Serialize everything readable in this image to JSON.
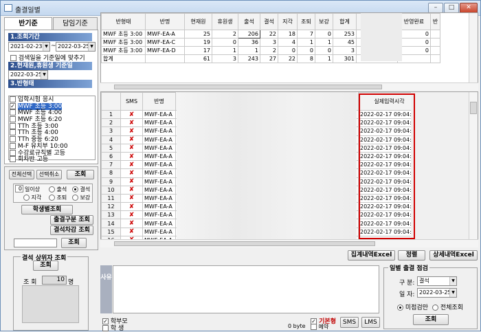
{
  "window": {
    "title": "출결일별",
    "minimize": "–",
    "maximize": "□",
    "close": "✕"
  },
  "tabs": {
    "left": "반기준",
    "right": "담임기준"
  },
  "section1": {
    "title": "1.조회기간",
    "date_from": "2021-02-23",
    "sep": "~",
    "date_to": "2022-03-25",
    "checkbox_label": "검색일을 기준일에 맞추기"
  },
  "section2": {
    "title": "2.현재원,휴원생 기준일",
    "date": "2022-03-25"
  },
  "section3": {
    "title": "3.반형태",
    "classes": [
      {
        "label": "입학시험 응시",
        "checked": false,
        "selected": false
      },
      {
        "label": "MWF 초등 3:00",
        "checked": true,
        "selected": true
      },
      {
        "label": "MWF 초등 4:00",
        "checked": false,
        "selected": false
      },
      {
        "label": "MWF 초등 6:20",
        "checked": false,
        "selected": false
      },
      {
        "label": "TTh 초등 3:00",
        "checked": false,
        "selected": false
      },
      {
        "label": "TTh 초등 4:00",
        "checked": false,
        "selected": false
      },
      {
        "label": "TTh 중등 6:20",
        "checked": false,
        "selected": false
      },
      {
        "label": "M-F 유치부 10:00",
        "checked": false,
        "selected": false
      },
      {
        "label": "수강료규칙별 고등",
        "checked": false,
        "selected": false
      },
      {
        "label": "회차반 고등",
        "checked": false,
        "selected": false
      }
    ]
  },
  "buttons": {
    "select_all": "전체선택",
    "deselect": "선택취소",
    "query": "조회",
    "by_student": "학생별조회",
    "attendance_type": "출결구분 조회",
    "absence_diff": "결석차감 조회",
    "query2": "조회",
    "query3": "조회",
    "query4": "조회",
    "total_excel": "집계내역Excel",
    "sort": "정렬",
    "detail_excel": "상세내역Excel",
    "sms": "SMS",
    "lms": "LMS"
  },
  "filter": {
    "count": "0",
    "count_suffix": "일이상",
    "radios": [
      {
        "label": "출석",
        "on": false
      },
      {
        "label": "결석",
        "on": true
      },
      {
        "label": "지각",
        "on": false
      },
      {
        "label": "조퇴",
        "on": false
      },
      {
        "label": "보강",
        "on": false
      }
    ]
  },
  "absent_top": {
    "title": "결석 상위자 조회",
    "count_label": "조 회",
    "count_value": "10",
    "count_unit": "명"
  },
  "summary": {
    "headers": [
      "반형태",
      "반명",
      "현재원",
      "휴원생",
      "출석",
      "결석",
      "지각",
      "조퇴",
      "보강",
      "합계",
      "반영예정",
      "반영완료",
      "반"
    ],
    "rows": [
      {
        "type": "MWF 초등 3:00",
        "name": "MWF-EA-A",
        "cur": "25",
        "rest": "2",
        "att": "206",
        "abs": "22",
        "late": "18",
        "early": "7",
        "makeup": "0",
        "total": "253",
        "plan": "22",
        "done": "0"
      },
      {
        "type": "MWF 초등 3:00",
        "name": "MWF-EA-C",
        "cur": "19",
        "rest": "0",
        "att": "36",
        "abs": "3",
        "late": "4",
        "early": "1",
        "makeup": "1",
        "total": "45",
        "plan": "3",
        "done": "0"
      },
      {
        "type": "MWF 초등 3:00",
        "name": "MWF-EA-D",
        "cur": "17",
        "rest": "1",
        "att": "1",
        "abs": "2",
        "late": "0",
        "early": "0",
        "makeup": "0",
        "total": "3",
        "plan": "2",
        "done": "0"
      }
    ],
    "total": {
      "label": "합계",
      "cur": "61",
      "rest": "3",
      "att": "243",
      "abs": "27",
      "late": "22",
      "early": "8",
      "makeup": "1",
      "total": "301"
    }
  },
  "detail": {
    "headers": {
      "sms": "SMS",
      "name": "반명",
      "time": "실제입력시각"
    },
    "rows": [
      {
        "no": "1",
        "name": "MWF-EA-A",
        "time": "2022-02-17 09:04:23"
      },
      {
        "no": "2",
        "name": "MWF-EA-A",
        "time": "2022-02-17 09:04:23"
      },
      {
        "no": "3",
        "name": "MWF-EA-A",
        "time": "2022-02-17 09:04:23"
      },
      {
        "no": "4",
        "name": "MWF-EA-A",
        "time": "2022-02-17 09:04:23"
      },
      {
        "no": "5",
        "name": "MWF-EA-A",
        "time": "2022-02-17 09:04:23"
      },
      {
        "no": "6",
        "name": "MWF-EA-A",
        "time": "2022-02-17 09:04:23"
      },
      {
        "no": "7",
        "name": "MWF-EA-A",
        "time": "2022-02-17 09:04:23"
      },
      {
        "no": "8",
        "name": "MWF-EA-A",
        "time": "2022-02-17 09:04:23"
      },
      {
        "no": "9",
        "name": "MWF-EA-A",
        "time": "2022-02-17 09:04:23"
      },
      {
        "no": "10",
        "name": "MWF-EA-A",
        "time": "2022-02-17 09:04:23"
      },
      {
        "no": "11",
        "name": "MWF-EA-A",
        "time": "2022-02-17 09:04:23"
      },
      {
        "no": "12",
        "name": "MWF-EA-A",
        "time": "2022-02-17 09:04:23"
      },
      {
        "no": "13",
        "name": "MWF-EA-A",
        "time": "2022-02-17 09:04:23"
      },
      {
        "no": "14",
        "name": "MWF-EA-A",
        "time": "2022-02-17 09:04:23"
      },
      {
        "no": "15",
        "name": "MWF-EA-A",
        "time": "2022-02-17 09:04:23"
      },
      {
        "no": "16",
        "name": "MWF-EA-A",
        "time": "2022-02-17 09:04:23"
      }
    ]
  },
  "reason": {
    "label": "사유",
    "byte_count": "0 byte",
    "parent": "학부모",
    "student": "학 생",
    "default_type": "기본형",
    "review": "예약"
  },
  "daily": {
    "title": "일별 출결 점검",
    "type_label": "구 분:",
    "type_value": "결석",
    "date_label": "일 자:",
    "date_value": "2022-03-25",
    "radio_unchecked": "미점검만",
    "radio_all": "전체조회"
  },
  "colors": {
    "accent": "#2b4d8c",
    "highlight": "#d00000",
    "selection": "#3169c6"
  }
}
